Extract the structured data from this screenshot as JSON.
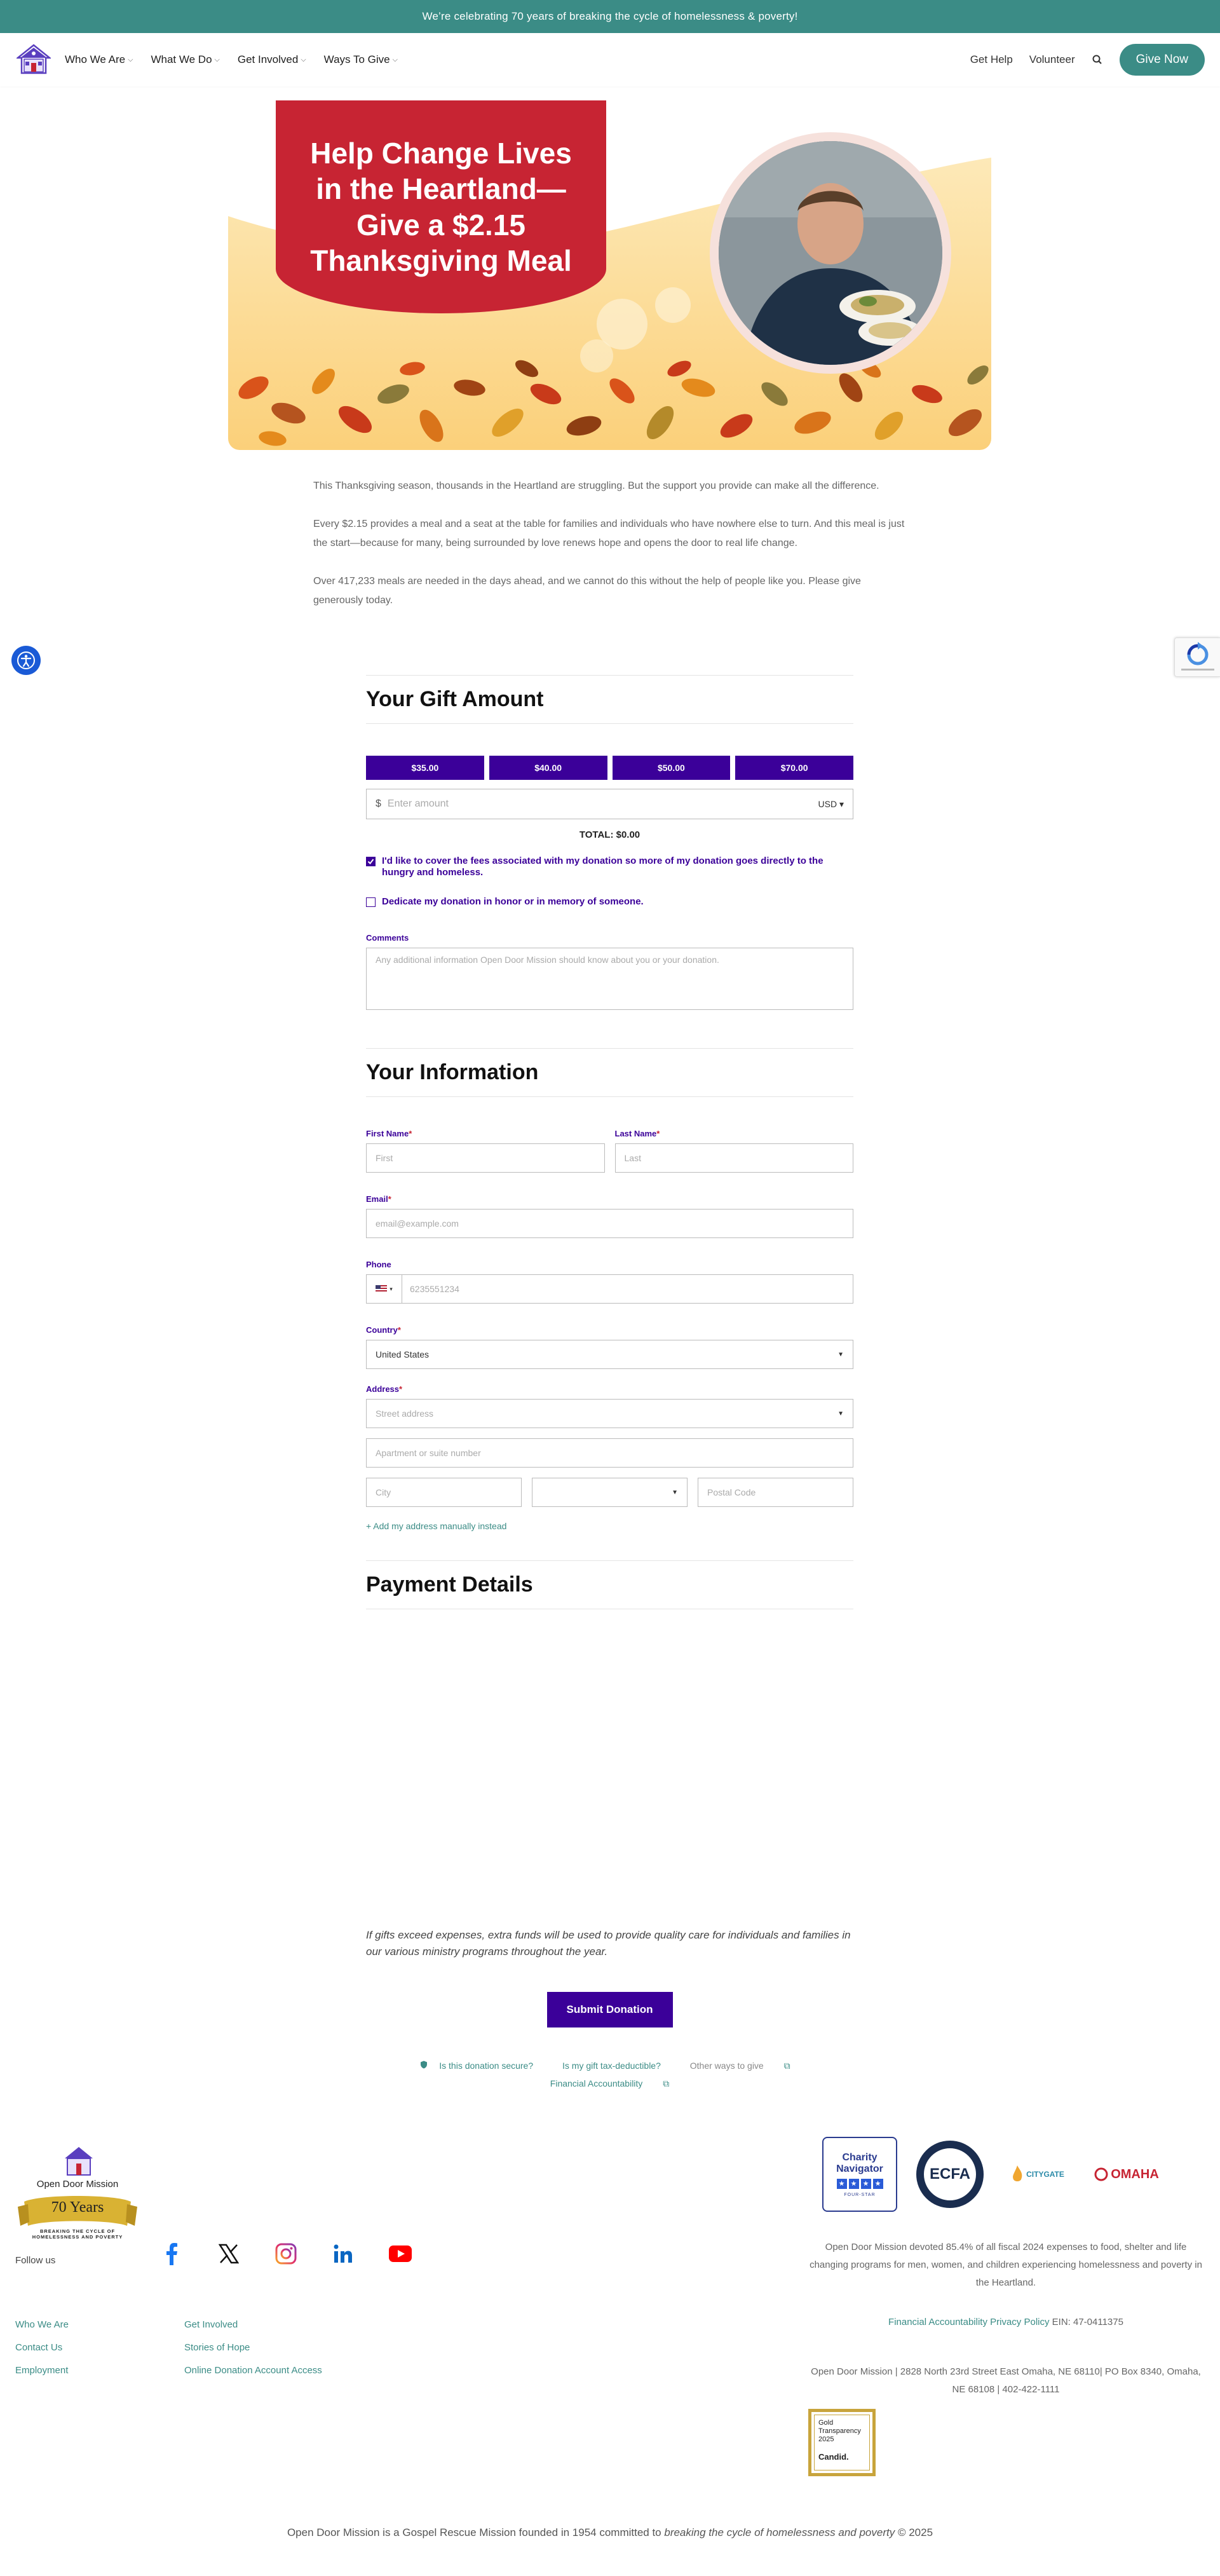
{
  "announcement": "We’re celebrating 70 years of breaking the cycle of homelessness & poverty!",
  "nav": {
    "items": [
      "Who We Are",
      "What We Do",
      "Get Involved",
      "Ways To Give"
    ],
    "right_links": [
      "Get Help",
      "Volunteer"
    ],
    "give_label": "Give Now"
  },
  "hero": {
    "title": "Help Change Lives in the Heartland—Give a $2.15 Thanksgiving Meal"
  },
  "intro": [
    "This Thanksgiving season, thousands in the Heartland are struggling. But the support you provide can make all the difference.",
    "Every $2.15 provides a meal and a seat at the table for families and individuals who have nowhere else to turn. And this meal is just the start—because for many, being surrounded by love renews hope and opens the door to real life change.",
    "Over 417,233 meals are needed in the days ahead, and we cannot do this without the help of people like you. Please give generously today."
  ],
  "gift": {
    "heading": "Your Gift Amount",
    "amounts": [
      "$35.00",
      "$40.00",
      "$50.00",
      "$70.00"
    ],
    "currency_symbol": "$",
    "amount_placeholder": "Enter amount",
    "currency": "USD",
    "total": "TOTAL: $0.00",
    "cover_fees": "I'd like to cover the fees associated with my donation so more of my donation goes directly to the hungry and homeless.",
    "dedicate": "Dedicate my donation in honor or in memory of someone.",
    "comments_label": "Comments",
    "comments_placeholder": "Any additional information Open Door Mission should know about you or your donation."
  },
  "info": {
    "heading": "Your Information",
    "first_label": "First Name",
    "first_ph": "First",
    "last_label": "Last Name",
    "last_ph": "Last",
    "email_label": "Email",
    "email_ph": "email@example.com",
    "phone_label": "Phone",
    "phone_ph": "6235551234",
    "country_label": "Country",
    "country_value": "United States",
    "address_label": "Address",
    "street_ph": "Street address",
    "apt_ph": "Apartment or suite number",
    "city_ph": "City",
    "postal_ph": "Postal Code",
    "add_manual": "+  Add my address manually instead",
    "required_mark": "*"
  },
  "payment": {
    "heading": "Payment Details",
    "disclaimer": "If gifts exceed expenses, extra funds will be used to provide quality care for individuals and families in our various ministry programs throughout the year.",
    "submit": "Submit Donation",
    "secure": "Is this donation secure?",
    "tax": "Is my gift tax-deductible?",
    "other": "Other ways to give",
    "fin": "Financial Accountability"
  },
  "footer": {
    "logo_text": "Open Door Mission",
    "logo_years": "70 Years",
    "logo_tagline": "BREAKING THE CYCLE OF HOMELESSNESS AND POVERTY",
    "follow": "Follow us",
    "col1": [
      "Who We Are",
      "Contact Us",
      "Employment"
    ],
    "col2": [
      "Get Involved",
      "Stories of Hope",
      "Online Donation Account Access"
    ],
    "stat": "Open Door Mission devoted 85.4% of all fiscal 2024 expenses to food, shelter and life changing programs for men, women, and children experiencing homelessness and poverty in the Heartland.",
    "fin_link": "Financial Accountability",
    "privacy_link": "Privacy Policy",
    "ein": "EIN: 47-0411375",
    "address": "Open Door Mission | 2828 North 23rd Street East Omaha, NE 68110| PO Box 8340, Omaha, NE 68108 | 402-422-1111",
    "candid": [
      "Gold",
      "Transparency",
      "2025",
      "Candid."
    ],
    "charity_nav": [
      "Charity",
      "Navigator",
      "FOUR-STAR"
    ],
    "ecfa": "ECFA",
    "citygate": "CITYGATE",
    "omaha": "OMAHA",
    "bottom_pre": "Open Door Mission is a Gospel Rescue Mission founded in 1954 committed to ",
    "bottom_em": "breaking the cycle of homelessness and poverty",
    "bottom_post": " © 2025"
  }
}
